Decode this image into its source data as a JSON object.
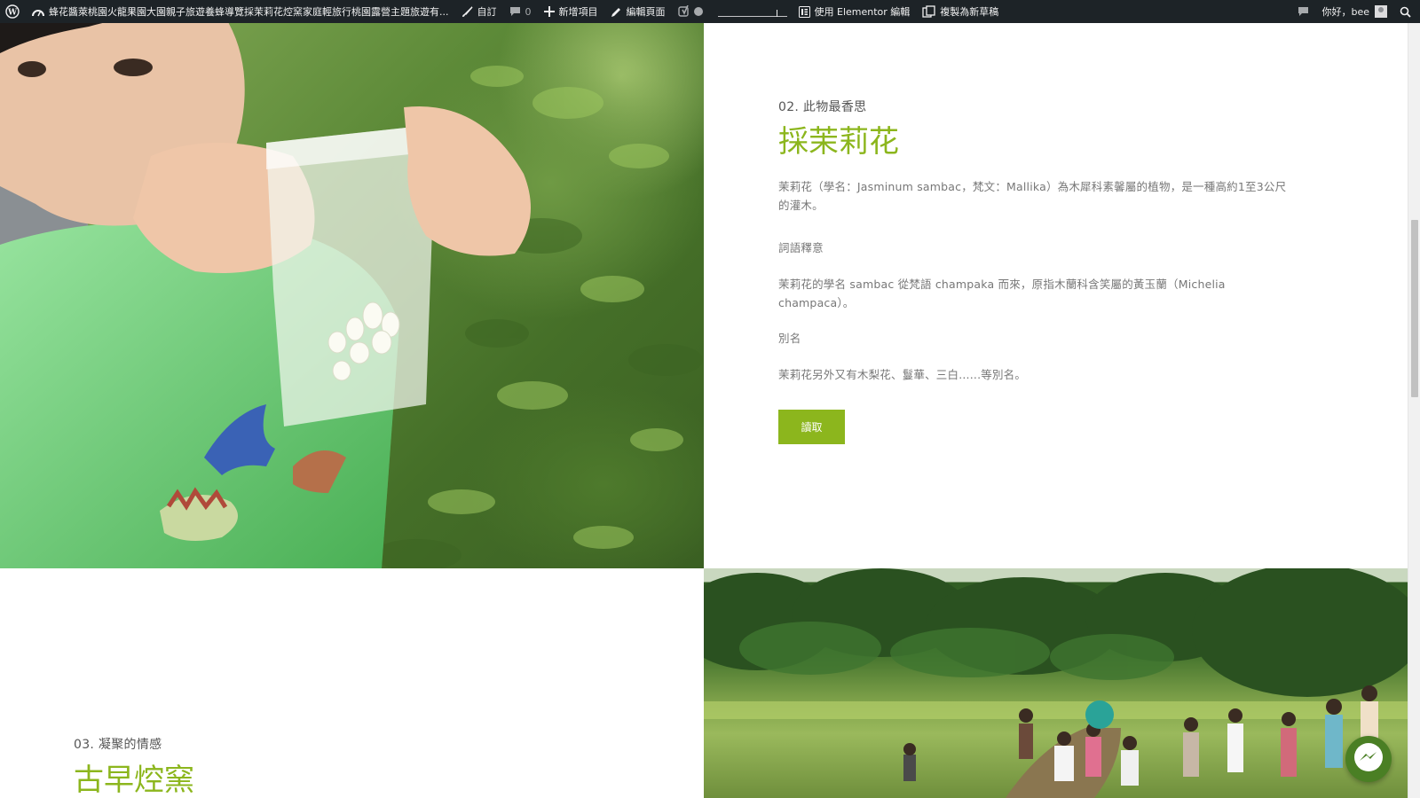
{
  "adminbar": {
    "site_title": "蜂花醬萊桃園火龍果園大園親子旅遊養蜂導覽採茉莉花焢窯家庭輕旅行桃園露營主題旅遊有...",
    "customize": "自訂",
    "comments_count": "0",
    "new_item": "新增項目",
    "edit_page": "編輯頁面",
    "elementor": "使用 Elementor 編輯",
    "duplicate": "複製為新草稿",
    "greeting": "你好，bee"
  },
  "section2": {
    "number": "02. 此物最香思",
    "title": "採茉莉花",
    "para1": "茉莉花（學名：Jasminum sambac，梵文：Mallika）為木犀科素馨屬的植物，是一種高約1至3公尺的灌木。",
    "label1": "詞語釋意",
    "para2": "茉莉花的學名 sambac 從梵語 champaka 而來，原指木蘭科含笑屬的黃玉蘭（Michelia champaca）。",
    "label2": "別名",
    "para3": "茉莉花另外又有木梨花、鬘華、三白......等別名。",
    "button": "讀取"
  },
  "section3": {
    "number": "03. 凝聚的情感",
    "title": "古早焢窯"
  },
  "colors": {
    "accent": "#8cb61d",
    "adminbar": "#1d2327",
    "text": "#777777"
  },
  "icons": {
    "wordpress": "wordpress-icon",
    "dashboard": "dashboard-icon",
    "customize": "brush-icon",
    "comments": "comment-icon",
    "new": "plus-icon",
    "edit": "pencil-icon",
    "yoast": "yoast-icon",
    "elementor": "elementor-icon",
    "duplicate": "duplicate-icon",
    "search": "search-icon",
    "messenger": "messenger-icon"
  }
}
